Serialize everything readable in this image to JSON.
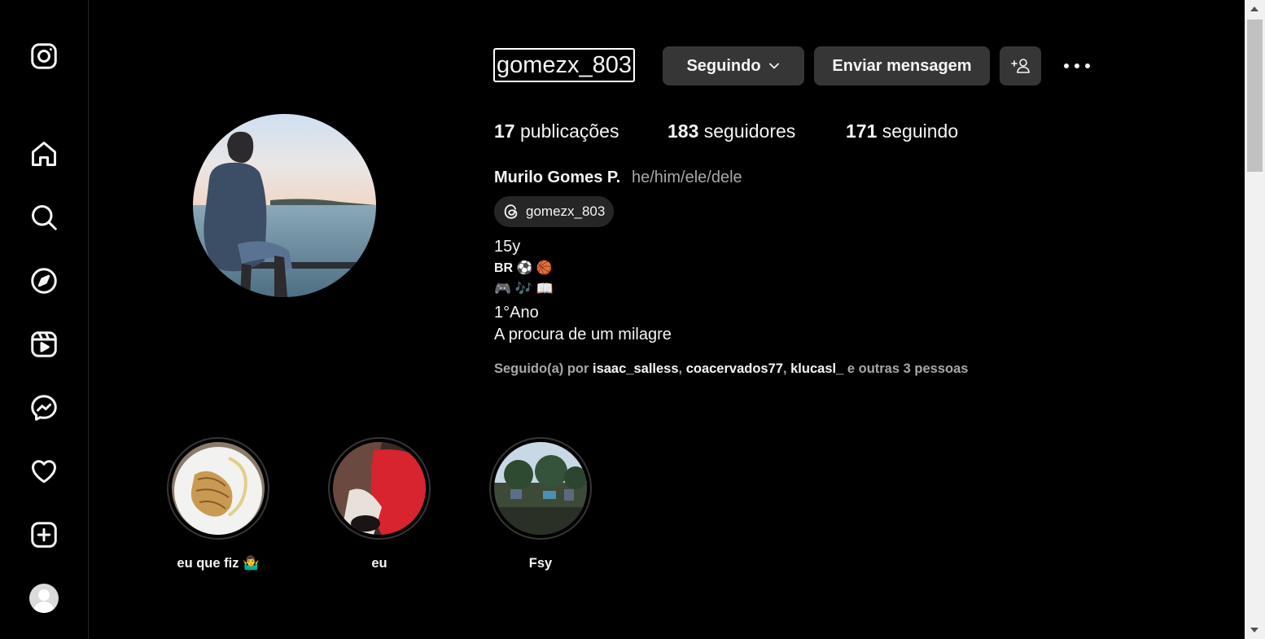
{
  "sidebar": {
    "items": [
      {
        "name": "instagram-logo-icon"
      },
      {
        "name": "home-icon"
      },
      {
        "name": "search-icon"
      },
      {
        "name": "explore-icon"
      },
      {
        "name": "reels-icon"
      },
      {
        "name": "messenger-icon"
      },
      {
        "name": "notifications-heart-icon"
      },
      {
        "name": "create-icon"
      },
      {
        "name": "profile-avatar"
      }
    ]
  },
  "header": {
    "username": "gomezx_803",
    "following_label": "Seguindo",
    "message_label": "Enviar mensagem"
  },
  "stats": {
    "posts_count": "17",
    "posts_label": "publicações",
    "followers_count": "183",
    "followers_label": "seguidores",
    "following_count": "171",
    "following_label": "seguindo"
  },
  "bio": {
    "full_name": "Murilo Gomes P.",
    "pronouns": "he/him/ele/dele",
    "threads_handle": "gomezx_803",
    "lines": [
      "15y",
      "BR ⚽ 🏀",
      "🎮 🎶 📖",
      "1°Ano",
      "A procura de um milagre"
    ]
  },
  "followed_by": {
    "prefix": "Seguido(a) por ",
    "users": [
      "isaac_salless",
      "coacervados77",
      "klucasl_"
    ],
    "suffix": " e outras 3 pessoas"
  },
  "highlights": [
    {
      "label": "eu que fiz 🤷‍♂️"
    },
    {
      "label": "eu"
    },
    {
      "label": "Fsy"
    }
  ],
  "colors": {
    "background": "#000000",
    "button": "#363636",
    "text": "#f5f5f5",
    "muted": "#a8a8a8"
  }
}
